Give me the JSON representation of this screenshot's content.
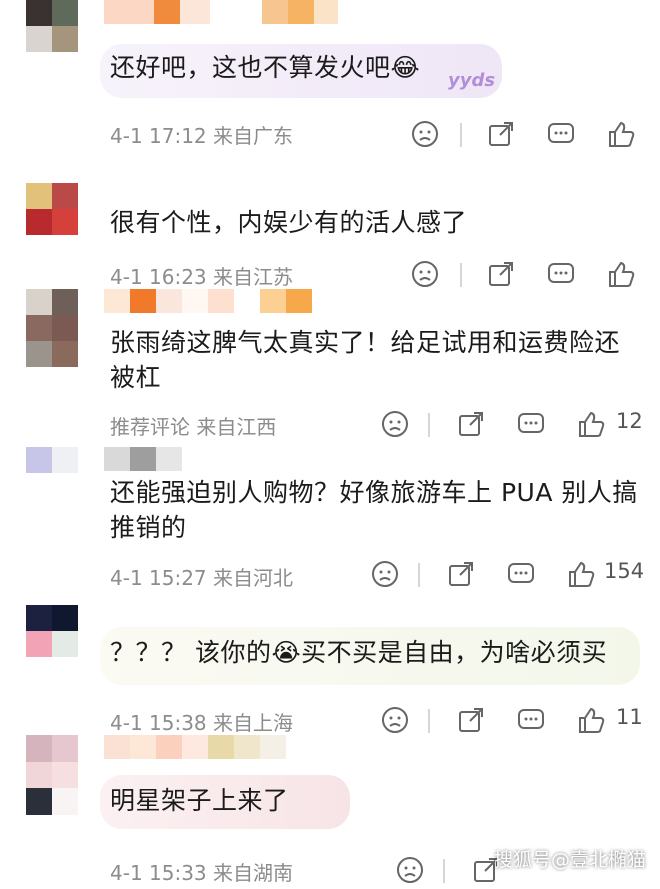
{
  "comments": [
    {
      "text": "还好吧，这也不算发火吧😂",
      "meta": "4-1 17:12  来自广东",
      "likes": "",
      "sticker": "yyds"
    },
    {
      "text": "很有个性，内娱少有的活人感了",
      "meta": "4-1 16:23  来自江苏",
      "likes": ""
    },
    {
      "text": "张雨绮这脾气太真实了！给足试用和运费险还被杠",
      "meta": "推荐评论  来自江西",
      "likes": "12"
    },
    {
      "text": "还能强迫别人购物？好像旅游车上 PUA 别人搞推销的",
      "meta": "4-1 15:27  来自河北",
      "likes": "154"
    },
    {
      "text": "？？？ 该你的😭买不买是自由，为啥必须买",
      "meta": "4-1 15:38  来自上海",
      "likes": "11"
    },
    {
      "text": "明星架子上来了",
      "meta": "4-1 15:33  来自湖南",
      "likes": ""
    }
  ],
  "icons": [
    "dislike-face-icon",
    "share-icon",
    "comment-icon",
    "like-thumb-icon"
  ],
  "watermark": "搜狐号@壹北椭猫",
  "colors": {
    "bubble": "#efe6f6",
    "meta": "#8c8c8c",
    "divider": "#d6d6d6"
  }
}
